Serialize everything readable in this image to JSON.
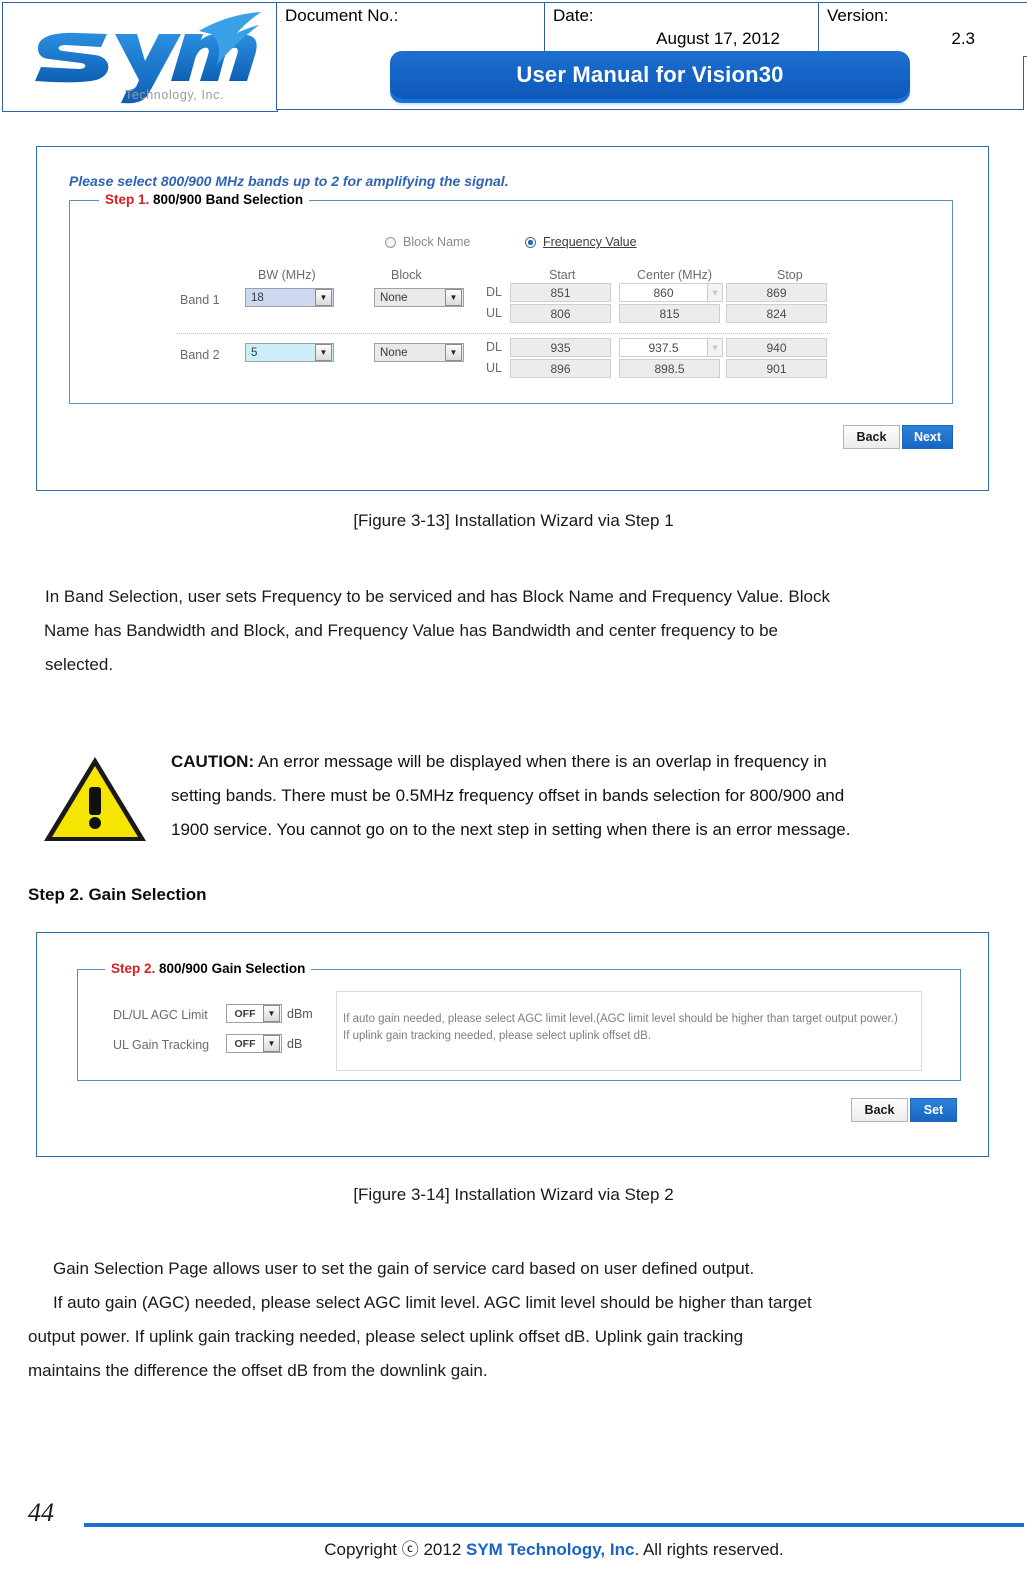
{
  "header": {
    "logo_alt": "SYM Technology, Inc.",
    "logo_wordmark": "sym",
    "logo_tagline": "Technology, Inc.",
    "doc_no_label": "Document No.:",
    "doc_no_value": "",
    "date_label": "Date:",
    "date_value": "August 17, 2012",
    "version_label": "Version:",
    "version_value": "2.3",
    "manual_title": "User Manual for Vision30"
  },
  "figure1": {
    "hint": "Please select 800/900 MHz bands up to 2 for amplifying the signal.",
    "group_legend_step": "Step 1.",
    "group_legend_rest": " 800/900 Band Selection",
    "radios": [
      {
        "label": "Block Name",
        "selected": false
      },
      {
        "label": "Frequency Value",
        "selected": true
      }
    ],
    "col_headers": {
      "bw": "BW (MHz)",
      "block": "Block",
      "start": "Start",
      "center": "Center (MHz)",
      "stop": "Stop"
    },
    "rows": [
      {
        "band_label": "Band 1",
        "bw_value": "18",
        "block_value": "None",
        "dl_label": "DL",
        "ul_label": "UL",
        "dl_start": "851",
        "dl_center": "860",
        "dl_stop": "869",
        "ul_start": "806",
        "ul_center": "815",
        "ul_stop": "824"
      },
      {
        "band_label": "Band 2",
        "bw_value": "5",
        "block_value": "None",
        "dl_label": "DL",
        "ul_label": "UL",
        "dl_start": "935",
        "dl_center": "937.5",
        "dl_stop": "940",
        "ul_start": "896",
        "ul_center": "898.5",
        "ul_stop": "901"
      }
    ],
    "buttons": {
      "back": "Back",
      "next": "Next"
    },
    "caption": "[Figure 3-13] Installation Wizard via Step 1"
  },
  "body1": {
    "line1": "In Band Selection, user sets Frequency to be serviced and has Block Name and Frequency Value. Block",
    "line2": "Name has Bandwidth and Block, and Frequency Value has Bandwidth and center frequency to be",
    "line3": "selected."
  },
  "caution": {
    "keyword": "CAUTION:",
    "line1": " An error message will be displayed when there is an overlap in frequency in",
    "line2": "setting bands. There must be 0.5MHz frequency offset in bands selection for 800/900 and",
    "line3": "1900 service. You cannot go on to the next step in setting when there is an error message."
  },
  "step2_heading": "Step 2. Gain Selection",
  "figure2": {
    "group_legend_step": "Step 2.",
    "group_legend_rest": " 800/900 Gain Selection",
    "fields": [
      {
        "label": "DL/UL AGC Limit",
        "value": "OFF",
        "unit": "dBm"
      },
      {
        "label": "UL Gain Tracking",
        "value": "OFF",
        "unit": "dB"
      }
    ],
    "info_lines": [
      "If auto gain needed, please select AGC limit level.(AGC limit level should be higher than target output power.)",
      "If uplink gain tracking needed, please select uplink offset dB."
    ],
    "buttons": {
      "back": "Back",
      "set": "Set"
    },
    "caption": "[Figure 3-14] Installation Wizard via Step 2"
  },
  "body2": {
    "line1": "Gain Selection Page allows user to set the gain of service card based on user defined output.",
    "line2": "If auto gain (AGC) needed, please select AGC limit level. AGC limit level should be higher than target",
    "line3": "output power. If uplink gain tracking needed, please select uplink offset dB. Uplink gain tracking",
    "line4": "maintains the difference the offset dB from the downlink gain."
  },
  "footer": {
    "page_number": "44",
    "copyright_prefix": "Copyright ⓒ 2012 ",
    "brand": "SYM Technology, Inc",
    "copyright_suffix": ". All rights reserved."
  },
  "colors": {
    "brand_blue": "#1763c6",
    "frame_blue": "#2f6fb0",
    "step_red": "#d81f1f",
    "caution_yellow": "#f5e500"
  }
}
